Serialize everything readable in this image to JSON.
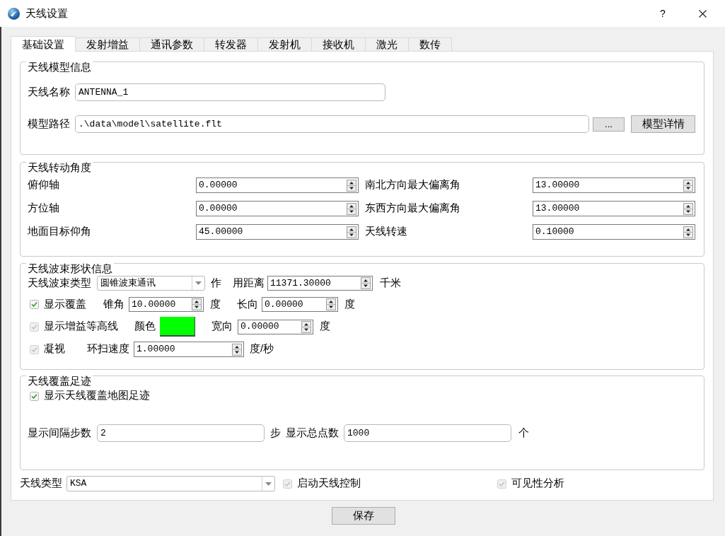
{
  "window": {
    "title": "天线设置",
    "help_button": "?"
  },
  "tabs": [
    {
      "label": "基础设置",
      "selected": true
    },
    {
      "label": "发射增益",
      "selected": false
    },
    {
      "label": "通讯参数",
      "selected": false
    },
    {
      "label": "转发器",
      "selected": false
    },
    {
      "label": "发射机",
      "selected": false
    },
    {
      "label": "接收机",
      "selected": false
    },
    {
      "label": "激光",
      "selected": false
    },
    {
      "label": "数传",
      "selected": false
    }
  ],
  "model_info": {
    "title": "天线模型信息",
    "name": {
      "label": "天线名称",
      "value": "ANTENNA_1"
    },
    "path": {
      "label": "模型路径",
      "value": ".\\data\\model\\satellite.flt",
      "browse_button": "...",
      "details_button": "模型详情"
    }
  },
  "rotation": {
    "title": "天线转动角度",
    "fields": [
      {
        "label": "俯仰轴",
        "value": "0.00000"
      },
      {
        "label": "南北方向最大偏离角",
        "value": "13.00000"
      },
      {
        "label": "方位轴",
        "value": "0.00000"
      },
      {
        "label": "东西方向最大偏离角",
        "value": "13.00000"
      },
      {
        "label": "地面目标仰角",
        "value": "45.00000"
      },
      {
        "label": "天线转速",
        "value": "0.10000"
      }
    ]
  },
  "beam": {
    "title": "天线波束形状信息",
    "lines": [
      {
        "items": [
          {
            "kind": "label",
            "text": "天线波束类型"
          },
          {
            "kind": "combo",
            "value": "圆锥波束通讯"
          },
          {
            "kind": "label",
            "text": "作"
          },
          {
            "kind": "label",
            "text": "用距离"
          },
          {
            "kind": "spin",
            "value": "11371.30000"
          },
          {
            "kind": "label",
            "text": "千米"
          }
        ]
      },
      {
        "items": [
          {
            "kind": "checkbox",
            "label": "显示覆盖",
            "checked": true,
            "disabled": false
          },
          {
            "kind": "label",
            "text": "锥角"
          },
          {
            "kind": "spin",
            "value": "10.00000"
          },
          {
            "kind": "label",
            "text": "度"
          },
          {
            "kind": "label",
            "text": "长向"
          },
          {
            "kind": "spin",
            "value": "0.00000"
          },
          {
            "kind": "label",
            "text": "度"
          }
        ]
      },
      {
        "items": [
          {
            "kind": "checkbox",
            "label": "显示增益等高线",
            "checked": true,
            "disabled": true
          },
          {
            "kind": "label",
            "text": "颜色"
          },
          {
            "kind": "swatch",
            "color": "#00ff00"
          },
          {
            "kind": "label",
            "text": "宽向"
          },
          {
            "kind": "spin",
            "value": "0.00000"
          },
          {
            "kind": "label",
            "text": "度"
          }
        ]
      },
      {
        "items": [
          {
            "kind": "checkbox",
            "label": "凝视",
            "checked": true,
            "disabled": true
          },
          {
            "kind": "label",
            "text": "环扫速度"
          },
          {
            "kind": "spin",
            "value": "1.00000"
          },
          {
            "kind": "label",
            "text": "度/秒"
          }
        ]
      }
    ]
  },
  "footprint": {
    "title": "天线覆盖足迹",
    "lines": [
      {
        "items": [
          {
            "kind": "checkbox",
            "label": "显示天线覆盖地图足迹",
            "checked": true,
            "disabled": false
          }
        ]
      },
      {
        "items": [
          {
            "kind": "label",
            "text": "显示间隔步数"
          },
          {
            "kind": "input",
            "value": "2"
          },
          {
            "kind": "label",
            "text": "步"
          },
          {
            "kind": "label",
            "text": "显示总点数"
          },
          {
            "kind": "input",
            "value": "1000"
          },
          {
            "kind": "label",
            "text": "个"
          }
        ]
      }
    ]
  },
  "bottom_row": [
    {
      "kind": "label",
      "text": "天线类型"
    },
    {
      "kind": "combo",
      "value": "KSA"
    },
    {
      "kind": "checkbox",
      "label": "启动天线控制",
      "checked": true,
      "disabled": true
    },
    {
      "kind": "checkbox",
      "label": "可见性分析",
      "checked": true,
      "disabled": true
    }
  ],
  "save_button": "保存"
}
